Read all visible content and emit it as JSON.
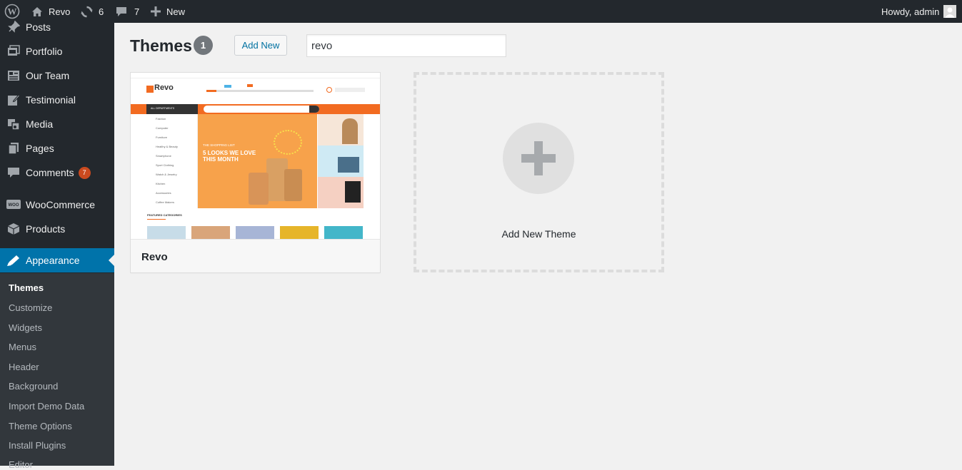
{
  "adminbar": {
    "site_name": "Revo",
    "updates_count": "6",
    "comments_count": "7",
    "new_label": "New",
    "greeting": "Howdy, admin"
  },
  "sidebar": {
    "items": [
      {
        "label": "Posts",
        "icon": "pin-icon"
      },
      {
        "label": "Portfolio",
        "icon": "portfolio-icon"
      },
      {
        "label": "Our Team",
        "icon": "team-icon"
      },
      {
        "label": "Testimonial",
        "icon": "testimonial-icon"
      },
      {
        "label": "Media",
        "icon": "media-icon"
      },
      {
        "label": "Pages",
        "icon": "pages-icon"
      },
      {
        "label": "Comments",
        "icon": "comments-icon",
        "badge": "7"
      },
      {
        "label": "WooCommerce",
        "icon": "woocommerce-icon"
      },
      {
        "label": "Products",
        "icon": "products-icon"
      },
      {
        "label": "Appearance",
        "icon": "appearance-icon"
      }
    ],
    "submenu": [
      "Themes",
      "Customize",
      "Widgets",
      "Menus",
      "Header",
      "Background",
      "Import Demo Data",
      "Theme Options",
      "Install Plugins",
      "Editor"
    ]
  },
  "main": {
    "title": "Themes",
    "count": "1",
    "add_new_label": "Add New",
    "search_value": "revo",
    "theme": {
      "name": "Revo",
      "screenshot": {
        "logo": "Revo",
        "banner_line1": "THE SHOPPING LIST",
        "banner_line2": "5 LOOKS WE LOVE",
        "banner_line3": "THIS MONTH",
        "all_departments": "ALL DEPARTMENTS",
        "featured": "FEATURED CATEGORIES",
        "categories": [
          "Fashion",
          "Computer",
          "Furniture",
          "Healthy & Beauty",
          "Smartphone",
          "Sport Clothing",
          "Watch & Jewelry",
          "Kitchen",
          "Accessories",
          "Coffee Makers"
        ]
      }
    },
    "add_theme_label": "Add New Theme"
  },
  "colors": {
    "adminbar_bg": "#23282d",
    "current_menu": "#0073aa",
    "badge": "#ca4a1f",
    "brand_orange": "#f26b21"
  }
}
